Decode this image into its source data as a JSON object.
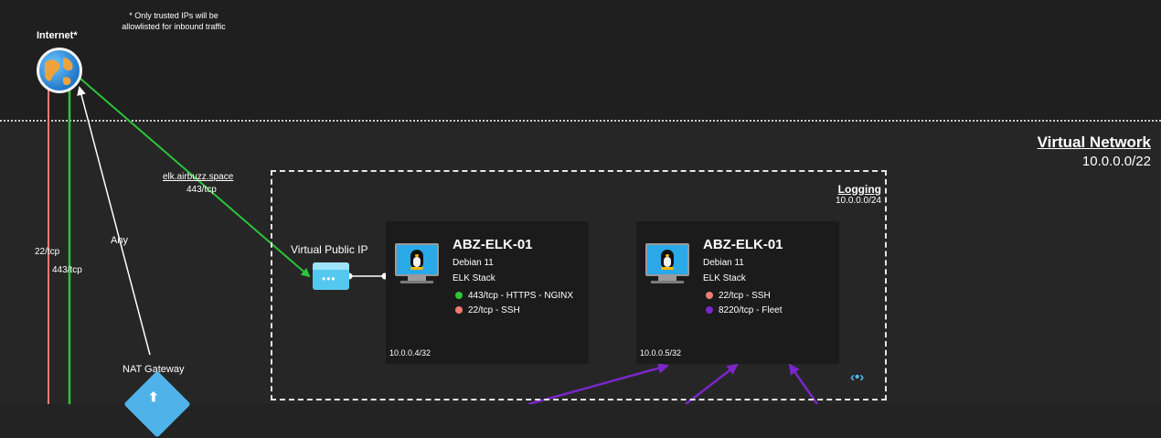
{
  "note": "* Only trusted IPs will be allowlisted for inbound traffic",
  "internet": {
    "label": "Internet*",
    "icon": "globe-icon"
  },
  "virtual_network": {
    "title": "Virtual Network",
    "cidr": "10.0.0.0/22"
  },
  "connections": {
    "domain": "elk.airbuzz.space",
    "domain_port": "443/tcp",
    "any": "Any",
    "port_22": "22/tcp",
    "port_443": "443/tcp"
  },
  "subnet": {
    "name": "Logging",
    "cidr": "10.0.0.0/24"
  },
  "public_ip": {
    "label": "Virtual Public IP",
    "icon": "public-ip-icon",
    "dots": "•••"
  },
  "vms": [
    {
      "name": "ABZ-ELK-01",
      "os": "Debian 11",
      "role": "ELK Stack",
      "ports": [
        {
          "label": "443/tcp - HTTPS - NGINX",
          "color": "#2bc43a"
        },
        {
          "label": "22/tcp - SSH",
          "color": "#f07a73"
        }
      ],
      "ip": "10.0.0.4/32"
    },
    {
      "name": "ABZ-ELK-01",
      "os": "Debian 11",
      "role": "ELK Stack",
      "ports": [
        {
          "label": "22/tcp - SSH",
          "color": "#f07a73"
        },
        {
          "label": "8220/tcp - Fleet",
          "color": "#7a26c9"
        }
      ],
      "ip": "10.0.0.5/32"
    }
  ],
  "nat_gateway": {
    "label": "NAT Gateway",
    "icon": "nat-gateway-icon",
    "arrow": "⬆"
  },
  "vnet_icon": {
    "glyph": "‹•›",
    "icon": "virtual-network-icon"
  },
  "colors": {
    "green": "#2bc43a",
    "red": "#f07a73",
    "white": "#ffffff",
    "purple": "#7a26c9",
    "azure": "#52b7ec"
  }
}
